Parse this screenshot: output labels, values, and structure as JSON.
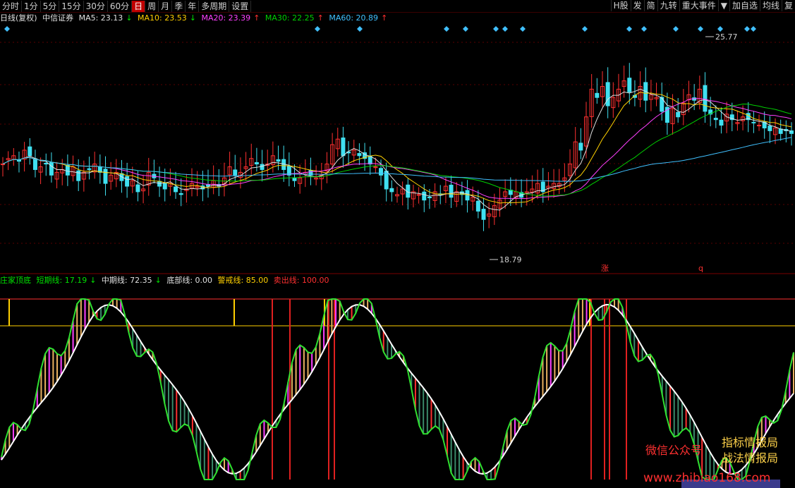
{
  "toolbar": {
    "items": [
      "分时",
      "1分",
      "5分",
      "15分",
      "30分",
      "60分",
      "日",
      "周",
      "月",
      "季",
      "年",
      "多周期",
      "设置"
    ],
    "active": "日",
    "right_items": [
      "H股",
      "发",
      "简",
      "九转",
      "重大事件",
      "加自选",
      "均线",
      "复"
    ]
  },
  "main_header": {
    "period": "日线(复权)",
    "stock": "中信证券",
    "ma": [
      {
        "label": "MA5: 23.13",
        "arrow": "↓",
        "color": "#e0e0e0"
      },
      {
        "label": "MA10: 23.53",
        "arrow": "↓",
        "color": "#ffd000"
      },
      {
        "label": "MA20: 23.39",
        "arrow": "↑",
        "color": "#ff40ff"
      },
      {
        "label": "MA30: 22.25",
        "arrow": "↑",
        "color": "#00d000"
      },
      {
        "label": "MA60: 20.89",
        "arrow": "↑",
        "color": "#40c0ff"
      }
    ]
  },
  "price_annotations": {
    "high": "25.77",
    "low": "18.79",
    "tag1": "涨",
    "tag2": "q"
  },
  "indicator_header": {
    "name": "庄家顶底",
    "items": [
      {
        "label": "短期线: 17.19",
        "arrow": "↓",
        "color": "#00e000"
      },
      {
        "label": "中期线: 72.35",
        "arrow": "↓",
        "color": "#e0e0e0"
      },
      {
        "label": "底部线: 0.00",
        "arrow": "",
        "color": "#e0e0e0"
      },
      {
        "label": "警戒线: 85.00",
        "arrow": "",
        "color": "#ffd000"
      },
      {
        "label": "卖出线: 100.00",
        "arrow": "",
        "color": "#ff3030"
      }
    ]
  },
  "watermark": {
    "wechat": "微信公众号",
    "line1": "指标情报局",
    "line2": "战法情报局",
    "site": "www.zhibiao168.com"
  },
  "chart_data": {
    "type": "candlestick",
    "ylim": [
      17.8,
      26.6
    ],
    "closes": [
      21.6,
      21.8,
      21.9,
      21.7,
      22.1,
      21.9,
      21.4,
      21.5,
      21.6,
      21.2,
      21.3,
      21.4,
      21.2,
      21.5,
      21.0,
      21.3,
      21.4,
      21.6,
      21.3,
      20.9,
      21.2,
      21.3,
      21.0,
      20.8,
      21.0,
      20.6,
      20.7,
      21.3,
      21.1,
      20.8,
      20.7,
      20.9,
      20.6,
      20.5,
      20.7,
      20.9,
      20.8,
      20.7,
      20.8,
      21.0,
      20.8,
      21.1,
      21.5,
      21.2,
      21.3,
      21.5,
      21.8,
      21.6,
      21.4,
      21.6,
      21.9,
      21.7,
      21.4,
      21.2,
      21.0,
      21.1,
      21.3,
      21.2,
      21.1,
      21.2,
      21.6,
      22.3,
      22.5,
      21.9,
      22.0,
      22.1,
      21.9,
      21.8,
      21.6,
      21.5,
      21.2,
      20.7,
      20.6,
      20.5,
      20.7,
      20.4,
      20.6,
      20.5,
      20.3,
      20.4,
      20.6,
      20.5,
      20.8,
      20.4,
      20.6,
      20.5,
      20.3,
      20.4,
      19.9,
      19.6,
      19.8,
      20.1,
      20.3,
      20.6,
      20.5,
      20.6,
      20.4,
      20.6,
      20.7,
      20.9,
      20.6,
      20.8,
      20.9,
      20.9,
      21.1,
      21.6,
      22.4,
      22.1,
      23.3,
      24.3,
      24.0,
      24.4,
      23.7,
      24.0,
      24.3,
      24.6,
      24.2,
      24.0,
      24.4,
      23.9,
      24.1,
      24.0,
      23.5,
      23.1,
      23.6,
      23.3,
      23.8,
      24.1,
      23.9,
      24.3,
      23.5,
      23.4,
      23.2,
      23.0,
      23.4,
      23.2,
      23.1,
      23.3,
      23.2,
      23.1,
      23.0,
      22.9,
      22.8,
      22.9,
      22.7,
      22.8,
      22.7
    ]
  }
}
